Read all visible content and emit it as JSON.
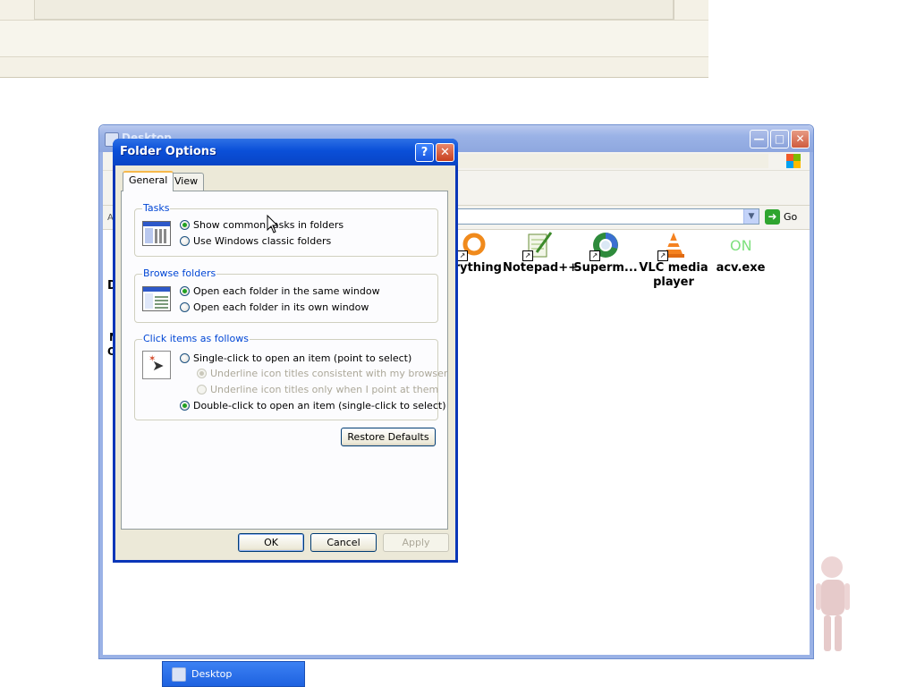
{
  "background_window": {},
  "explorer": {
    "title": "Desktop",
    "title_truncated_hint": "Desktop",
    "go_label": "Go",
    "left_clipped_letters": [
      "A",
      "D",
      "N",
      "O"
    ],
    "items": [
      {
        "label": "erything",
        "icon": "everything-icon",
        "shortcut": true
      },
      {
        "label": "Notepad++",
        "icon": "notepadpp-icon",
        "shortcut": true
      },
      {
        "label": "Superm...",
        "icon": "supermium-icon",
        "shortcut": true
      },
      {
        "label": "VLC media player",
        "icon": "vlc-icon",
        "shortcut": true
      },
      {
        "label": "acv.exe",
        "icon": "acv-exe-icon",
        "shortcut": false
      }
    ]
  },
  "dialog": {
    "title": "Folder Options",
    "help_button": "?",
    "close_button": "✕",
    "tabs": [
      {
        "label": "General",
        "active": true
      },
      {
        "label": "View",
        "active": false
      }
    ],
    "groups": {
      "tasks": {
        "title": "Tasks",
        "options": [
          {
            "label": "Show common tasks in folders",
            "checked": true
          },
          {
            "label": "Use Windows classic folders",
            "checked": false
          }
        ]
      },
      "browse": {
        "title": "Browse folders",
        "options": [
          {
            "label": "Open each folder in the same window",
            "checked": true
          },
          {
            "label": "Open each folder in its own window",
            "checked": false
          }
        ]
      },
      "click": {
        "title": "Click items as follows",
        "options": [
          {
            "label": "Single-click to open an item (point to select)",
            "checked": false,
            "disabled": false
          },
          {
            "label": "Underline icon titles consistent with my browser",
            "checked": true,
            "disabled": true
          },
          {
            "label": "Underline icon titles only when I point at them",
            "checked": false,
            "disabled": true
          },
          {
            "label": "Double-click to open an item (single-click to select)",
            "checked": true,
            "disabled": false
          }
        ]
      }
    },
    "restore_defaults": "Restore Defaults",
    "ok": "OK",
    "cancel": "Cancel",
    "apply": "Apply"
  },
  "taskbar": {
    "active_window": "Desktop"
  },
  "colors": {
    "xp_title_blue": "#0a4fd8",
    "dialog_face": "#ece9d8",
    "group_title": "#0046d5"
  }
}
